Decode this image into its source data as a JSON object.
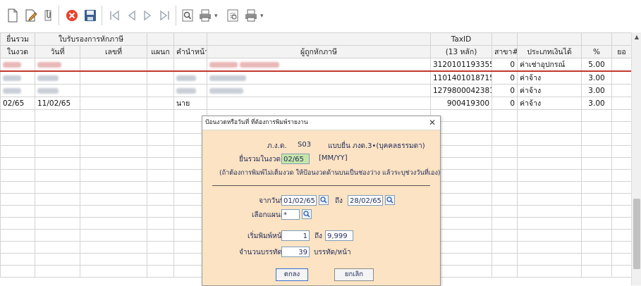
{
  "toolbar": {
    "icons": [
      "new-doc-icon",
      "edit-doc-icon",
      "attach-icon",
      "delete-icon",
      "save-icon",
      "first-record-icon",
      "prev-record-icon",
      "next-record-icon",
      "last-record-icon",
      "search-icon",
      "print-icon",
      "preview-icon",
      "print-icon"
    ]
  },
  "grid": {
    "headers_top": {
      "col1": "ยื่นรวม",
      "col23": "ใบรับรองการหักภาษี",
      "taxid": "TaxID"
    },
    "headers_bottom": {
      "period": "ในงวด",
      "date": "วันที่",
      "number": "เลขที่",
      "dept": "แผนก",
      "title": "คำนำหน้า",
      "payer": "ผู้ถูกหักภาษี",
      "taxid_sub": "(13 หลัก)",
      "branch": "สาขา#",
      "income_type": "ประเภทเงินได้",
      "percent": "%",
      "amount_short": "ยอ"
    },
    "rows": [
      {
        "period": "",
        "date": "",
        "title": "",
        "name": "",
        "taxid": "3120101193355",
        "branch": "0",
        "income": "ค่าเช่าอุปกรณ์",
        "pct": "5.00"
      },
      {
        "period": "",
        "date": "",
        "title": "",
        "name": "",
        "taxid": "1101401018715",
        "branch": "0",
        "income": "ค่าจ้าง",
        "pct": "3.00"
      },
      {
        "period": "",
        "date": "",
        "title": "",
        "name": "",
        "taxid": "1279800042381",
        "branch": "0",
        "income": "ค่าจ้าง",
        "pct": "3.00"
      },
      {
        "period": "02/65",
        "date": "11/02/65",
        "title": "นาย",
        "name": "",
        "taxid": "900419300",
        "branch": "0",
        "income": "ค่าจ้าง",
        "pct": "3.00"
      }
    ]
  },
  "dialog": {
    "title": "ป้อนงวดหรือวันที่ ที่ต้องการพิมพ์รายงาน",
    "form_label": "ภ.ง.ด.",
    "form_code": "S03",
    "form_desc": "แบบยื่น ภงด.3•(บุคคลธรรมดา)",
    "period_label": "ยื่นรวมในงวด",
    "period_value": "02/65",
    "period_hint": "[MM/YY]",
    "note": "(ถ้าต้องการพิมพ์ไม่เต็มงวด ให้ป้อนงวดด้านบนเป็นช่องว่าง แล้วระบุช่วงวันที่เอง)",
    "from_label": "จากวันที่",
    "from_value": "01/02/65",
    "to_label": "ถึง",
    "to_value": "28/02/65",
    "dept_label": "เลือกแผนก",
    "dept_value": "*",
    "start_page_label": "เริ่มพิมพ์หน้า",
    "start_page_value": "1",
    "end_page_label": "ถึง",
    "end_page_value": "9,999",
    "lines_label": "จำนวนบรรทัด",
    "lines_value": "39",
    "lines_unit": "บรรทัด/หน้า",
    "ok_label": "ตกลง",
    "cancel_label": "ยกเลิก",
    "close_glyph": "✕"
  }
}
